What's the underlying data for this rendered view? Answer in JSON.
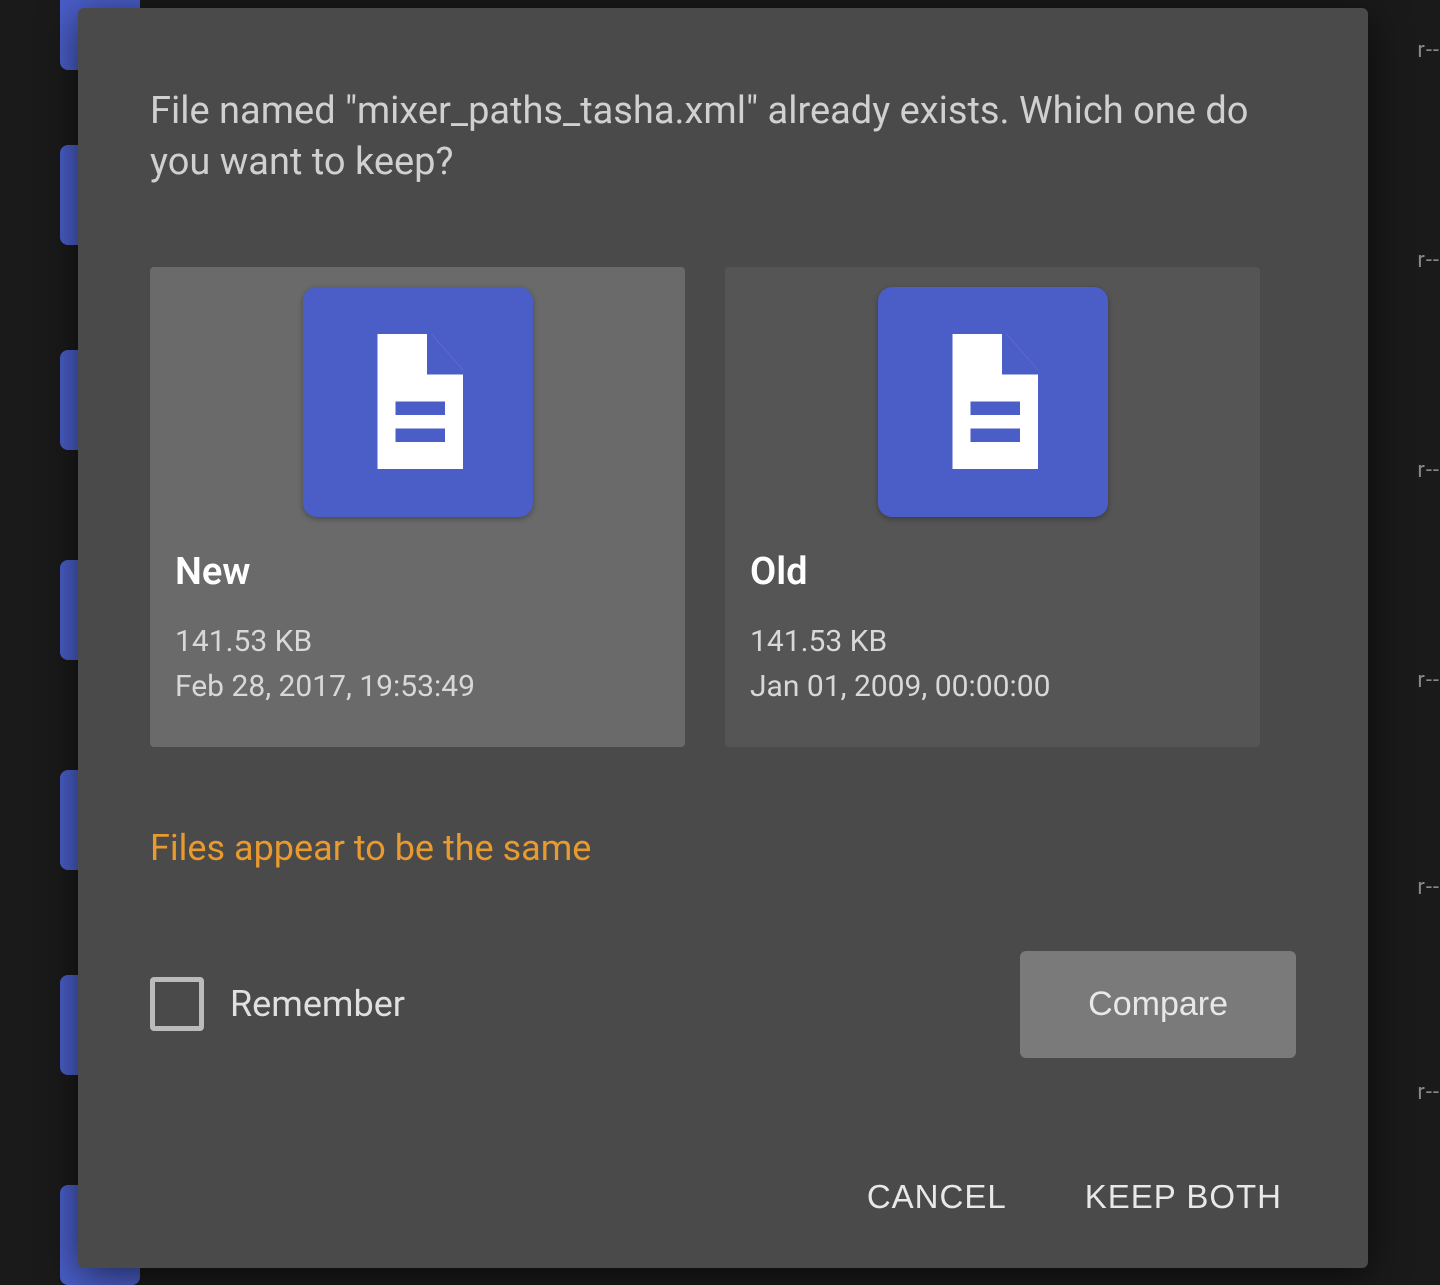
{
  "dialog": {
    "title": "File named \"mixer_paths_tasha.xml\" already exists. Which one do you want to keep?",
    "new_card": {
      "label": "New",
      "size": "141.53 KB",
      "date": "Feb 28, 2017, 19:53:49"
    },
    "old_card": {
      "label": "Old",
      "size": "141.53 KB",
      "date": "Jan 01, 2009, 00:00:00"
    },
    "same_notice": "Files appear to be the same",
    "remember_label": "Remember",
    "compare_label": "Compare",
    "cancel_label": "CANCEL",
    "keep_both_label": "KEEP BOTH"
  },
  "background": {
    "row_suffix": "r--"
  }
}
